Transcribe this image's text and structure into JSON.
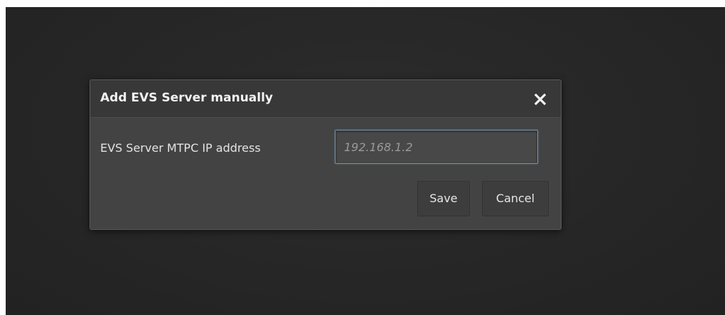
{
  "dialog": {
    "title": "Add EVS Server manually",
    "close_icon": "close-icon",
    "ip_field": {
      "label": "EVS Server MTPC IP address",
      "value": "",
      "placeholder": "192.168.1.2"
    },
    "buttons": {
      "save_label": "Save",
      "cancel_label": "Cancel"
    }
  },
  "colors": {
    "backdrop": "#262626",
    "dialog_body": "#434343",
    "dialog_header": "#383838",
    "input_focus_border": "#7a94ad",
    "text": "#e4e4e4"
  }
}
